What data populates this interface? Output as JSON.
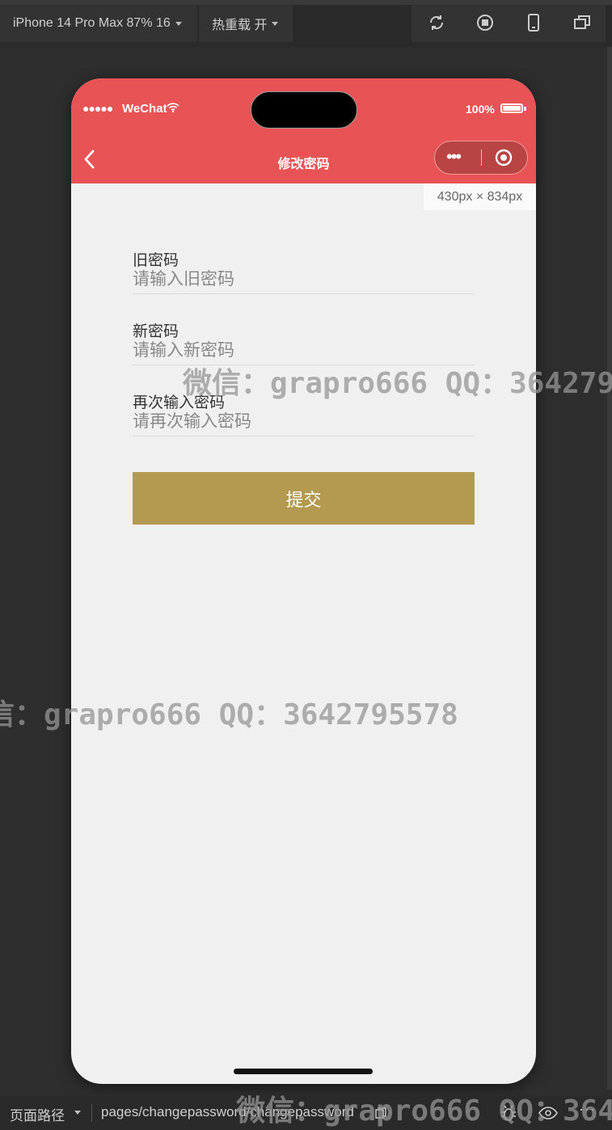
{
  "toolbar": {
    "device_label": "iPhone 14 Pro Max 87% 16",
    "hot_reload_label": "热重载 开"
  },
  "status_bar": {
    "signal": "●●●●●",
    "carrier": "WeChat",
    "battery_text": "100%"
  },
  "navbar": {
    "title": "修改密码",
    "capsule_more": "•••"
  },
  "viewport_size_label": "430px × 834px",
  "form": {
    "old_password": {
      "label": "旧密码",
      "placeholder": "请输入旧密码"
    },
    "new_password": {
      "label": "新密码",
      "placeholder": "请输入新密码"
    },
    "confirm_password": {
      "label": "再次输入密码",
      "placeholder": "请再次输入密码"
    },
    "submit_label": "提交"
  },
  "watermarks": {
    "top": "微信：grapro666 QQ：364279",
    "middle": "信：grapro666 QQ：3642795578",
    "bottom": "微信：grapro666 QQ：364"
  },
  "bottom_bar": {
    "path_label": "页面路径",
    "path": "pages/changepassword/changepassword",
    "more": "···"
  },
  "colors": {
    "header_red": "#e85455",
    "submit_gold": "#b39a50",
    "page_bg": "#f0f0f0"
  }
}
